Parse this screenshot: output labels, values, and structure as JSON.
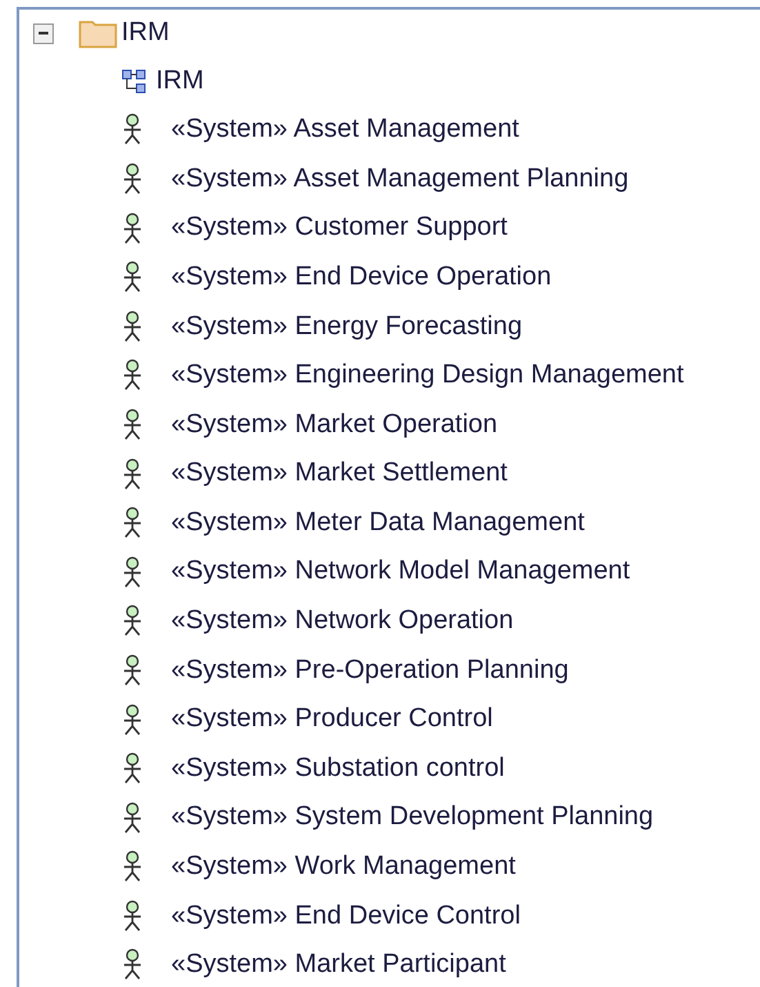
{
  "tree": {
    "label": "IRM",
    "expanded": true,
    "children": [
      {
        "kind": "diagram",
        "label": "IRM"
      },
      {
        "kind": "actor",
        "label": "«System» Asset Management"
      },
      {
        "kind": "actor",
        "label": "«System» Asset Management Planning"
      },
      {
        "kind": "actor",
        "label": "«System» Customer Support"
      },
      {
        "kind": "actor",
        "label": "«System» End Device Operation"
      },
      {
        "kind": "actor",
        "label": "«System» Energy Forecasting"
      },
      {
        "kind": "actor",
        "label": "«System» Engineering Design Management"
      },
      {
        "kind": "actor",
        "label": "«System» Market Operation"
      },
      {
        "kind": "actor",
        "label": "«System» Market Settlement"
      },
      {
        "kind": "actor",
        "label": "«System» Meter Data Management"
      },
      {
        "kind": "actor",
        "label": "«System» Network Model Management"
      },
      {
        "kind": "actor",
        "label": "«System» Network Operation"
      },
      {
        "kind": "actor",
        "label": "«System» Pre-Operation Planning"
      },
      {
        "kind": "actor",
        "label": "«System» Producer Control"
      },
      {
        "kind": "actor",
        "label": "«System» Substation control"
      },
      {
        "kind": "actor",
        "label": "«System» System Development Planning"
      },
      {
        "kind": "actor",
        "label": "«System» Work Management"
      },
      {
        "kind": "actor",
        "label": "«System» End Device Control"
      },
      {
        "kind": "actor",
        "label": "«System» Market Participant"
      }
    ]
  }
}
